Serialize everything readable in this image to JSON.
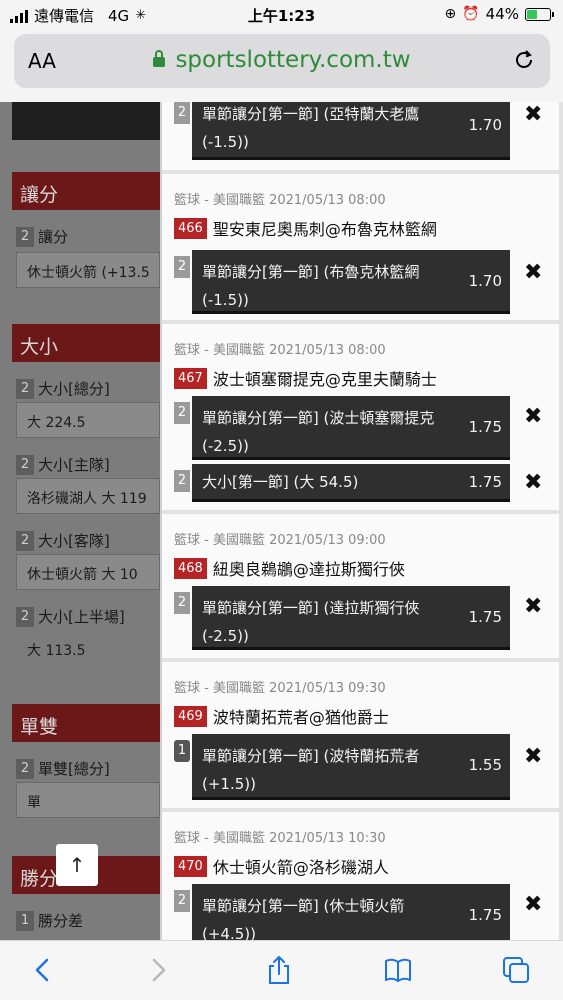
{
  "status": {
    "carrier": "遠傳電信",
    "network": "4G",
    "time": "上午1:23",
    "battery": "44%",
    "battery_level": 0.44
  },
  "browser": {
    "text_size_label": "AA",
    "url": "sportslottery.com.tw"
  },
  "background_page": {
    "sections": [
      {
        "title": "讓分",
        "items": [
          {
            "num": "2",
            "label": "讓分",
            "value": "休士頓火箭 (+13.5"
          }
        ]
      },
      {
        "title": "大小",
        "items": [
          {
            "num": "2",
            "label": "大小[總分]",
            "value": "大 224.5"
          },
          {
            "num": "2",
            "label": "大小[主隊]",
            "value": "洛杉磯湖人 大 119"
          },
          {
            "num": "2",
            "label": "大小[客隊]",
            "value": "休士頓火箭 大 10"
          },
          {
            "num": "2",
            "label": "大小[上半場]",
            "value": "大 113.5"
          }
        ]
      },
      {
        "title": "單雙",
        "items": [
          {
            "num": "2",
            "label": "單雙[總分]",
            "value": "單"
          }
        ]
      },
      {
        "title": "勝分",
        "items": [
          {
            "num": "1",
            "label": "勝分差"
          }
        ]
      }
    ],
    "scroll_top_icon": "↑"
  },
  "betslip": {
    "cards": [
      {
        "bets": [
          {
            "num": "2",
            "desc": "單節讓分[第一節] (亞特蘭大老鷹 (-1.5))",
            "odds": "1.70"
          }
        ]
      },
      {
        "meta": "籃球 - 美國職籃 2021/05/13 08:00",
        "code": "466",
        "match": "聖安東尼奧馬刺@布魯克林籃網",
        "bets": [
          {
            "num": "2",
            "desc": "單節讓分[第一節] (布魯克林籃網 (-1.5))",
            "odds": "1.70"
          }
        ]
      },
      {
        "meta": "籃球 - 美國職籃 2021/05/13 08:00",
        "code": "467",
        "match": "波士頓塞爾提克@克里夫蘭騎士",
        "bets": [
          {
            "num": "2",
            "desc": "單節讓分[第一節] (波士頓塞爾提克 (-2.5))",
            "odds": "1.75"
          },
          {
            "num": "2",
            "desc": "大小[第一節] (大 54.5)",
            "odds": "1.75"
          }
        ]
      },
      {
        "meta": "籃球 - 美國職籃 2021/05/13 09:00",
        "code": "468",
        "match": "紐奧良鵜鶘@達拉斯獨行俠",
        "bets": [
          {
            "num": "2",
            "desc": "單節讓分[第一節] (達拉斯獨行俠 (-2.5))",
            "odds": "1.75"
          }
        ]
      },
      {
        "meta": "籃球 - 美國職籃 2021/05/13 09:30",
        "code": "469",
        "match": "波特蘭拓荒者@猶他爵士",
        "bets": [
          {
            "num": "1",
            "desc": "單節讓分[第一節] (波特蘭拓荒者 (+1.5))",
            "odds": "1.55"
          }
        ]
      },
      {
        "meta": "籃球 - 美國職籃 2021/05/13 10:30",
        "code": "470",
        "match": "休士頓火箭@洛杉磯湖人",
        "bets": [
          {
            "num": "2",
            "desc": "單節讓分[第一節] (休士頓火箭 (+4.5))",
            "odds": "1.75"
          }
        ]
      }
    ],
    "remove_icon": "✖"
  },
  "icons": {
    "back": "chevron-left-icon",
    "forward": "chevron-right-icon",
    "share": "share-icon",
    "bookmarks": "book-icon",
    "tabs": "tabs-icon"
  }
}
